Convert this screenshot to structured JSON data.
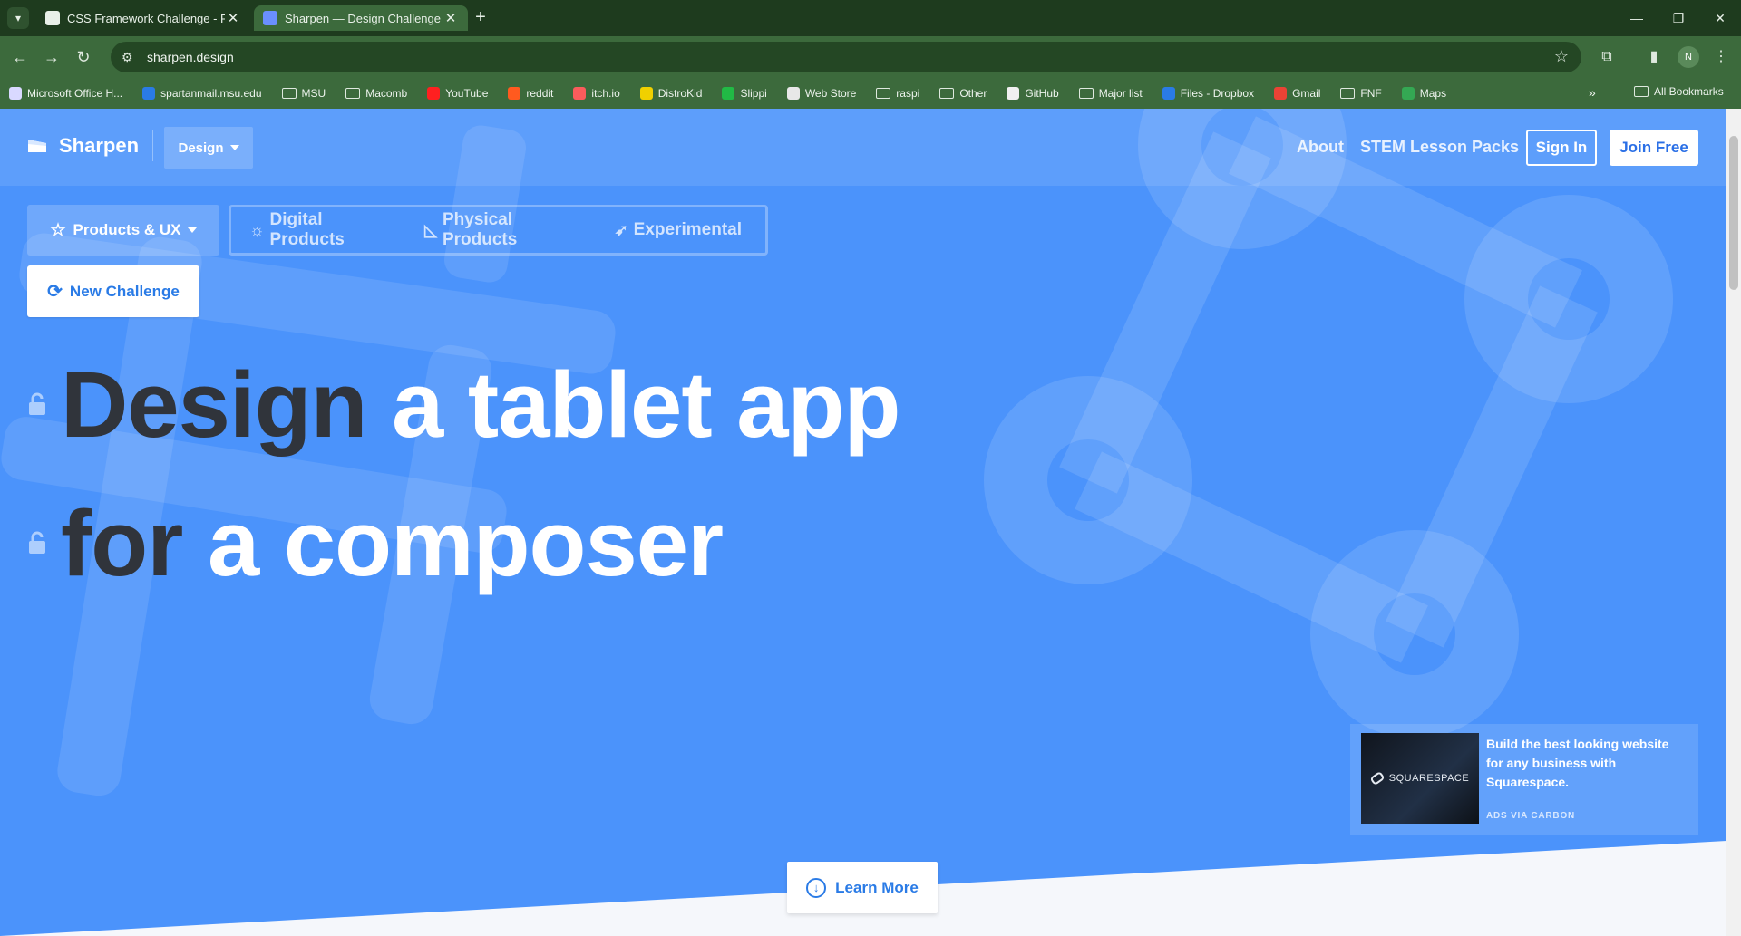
{
  "browser": {
    "tabs": [
      {
        "title": "CSS Framework Challenge - FS",
        "active": false,
        "favicon_color": "#e8f0e8"
      },
      {
        "title": "Sharpen — Design Challenge G",
        "active": true,
        "favicon_color": "#6a8fff"
      }
    ],
    "url": "sharpen.design",
    "profile_initial": "N",
    "bookmarks": [
      {
        "label": "Microsoft Office H...",
        "icon": "office-icon",
        "color": "#d9d9ff",
        "kind": "site"
      },
      {
        "label": "spartanmail.msu.edu",
        "icon": "outlook-icon",
        "color": "#2a7be6",
        "kind": "site"
      },
      {
        "label": "MSU",
        "icon": "folder-icon",
        "kind": "folder"
      },
      {
        "label": "Macomb",
        "icon": "folder-icon",
        "kind": "folder"
      },
      {
        "label": "YouTube",
        "icon": "youtube-icon",
        "color": "#ff2020",
        "kind": "site"
      },
      {
        "label": "reddit",
        "icon": "reddit-icon",
        "color": "#ff5a1f",
        "kind": "site"
      },
      {
        "label": "itch.io",
        "icon": "itchio-icon",
        "color": "#fa5c5c",
        "kind": "site"
      },
      {
        "label": "DistroKid",
        "icon": "distrokid-icon",
        "color": "#f0d000",
        "kind": "site"
      },
      {
        "label": "Slippi",
        "icon": "slippi-icon",
        "color": "#21ba45",
        "kind": "site"
      },
      {
        "label": "Web Store",
        "icon": "webstore-icon",
        "color": "#e8e8e8",
        "kind": "site"
      },
      {
        "label": "raspi",
        "icon": "folder-icon",
        "kind": "folder"
      },
      {
        "label": "Other",
        "icon": "folder-icon",
        "kind": "folder"
      },
      {
        "label": "GitHub",
        "icon": "github-icon",
        "color": "#f0f0f0",
        "kind": "site"
      },
      {
        "label": "Major list",
        "icon": "folder-icon",
        "kind": "folder"
      },
      {
        "label": "Files - Dropbox",
        "icon": "dropbox-icon",
        "color": "#2a7be6",
        "kind": "site"
      },
      {
        "label": "Gmail",
        "icon": "gmail-icon",
        "color": "#ea4335",
        "kind": "site"
      },
      {
        "label": "FNF",
        "icon": "folder-icon",
        "kind": "folder"
      },
      {
        "label": "Maps",
        "icon": "maps-icon",
        "color": "#34a853",
        "kind": "site"
      }
    ],
    "all_bookmarks": "All Bookmarks",
    "more_glyph": "»"
  },
  "site": {
    "brand": "Sharpen",
    "design_dropdown": "Design",
    "nav": {
      "about": "About",
      "stem": "STEM Lesson Packs",
      "signin": "Sign In",
      "join": "Join Free"
    },
    "category": "Products & UX",
    "filters": [
      {
        "label": "Digital Products",
        "glyph": "☼",
        "icon": "bug-icon"
      },
      {
        "label": "Physical Products",
        "glyph": "◺",
        "icon": "ruler-icon"
      },
      {
        "label": "Experimental",
        "glyph": "➶",
        "icon": "rocket-icon"
      }
    ],
    "new_challenge": "New Challenge",
    "headline": {
      "line1_dark": "Design",
      "line1_light": "a tablet app",
      "line2_dark": "for",
      "line2_light": "a composer"
    },
    "ad": {
      "brand": "SQUARESPACE",
      "text": "Build the best looking website for any business with Squarespace.",
      "via": "ADS VIA CARBON"
    },
    "learn_more": "Learn More"
  },
  "colors": {
    "page_blue": "#4b93fb",
    "accent_blue": "#2a7be6",
    "dark_text": "#30343b",
    "chrome_green": "#3c6a3c"
  }
}
